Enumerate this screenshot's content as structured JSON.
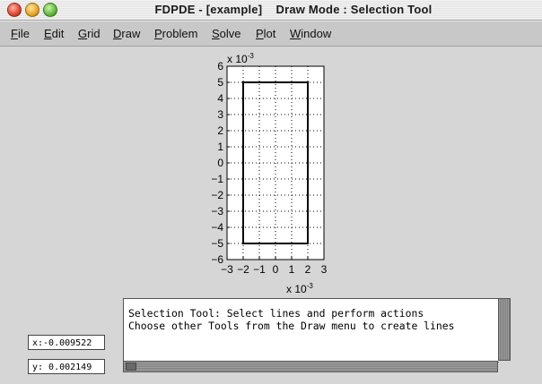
{
  "window": {
    "title": "FDPDE - [example]    Draw Mode : Selection Tool"
  },
  "menu": [
    {
      "label": "File",
      "mnemonic": "F",
      "rest": "ile"
    },
    {
      "label": "Edit",
      "mnemonic": "E",
      "rest": "dit"
    },
    {
      "label": "Grid",
      "mnemonic": "G",
      "rest": "rid"
    },
    {
      "label": "Draw",
      "mnemonic": "D",
      "rest": "raw"
    },
    {
      "label": "Problem",
      "mnemonic": "P",
      "rest": "roblem"
    },
    {
      "label": "Solve",
      "mnemonic": "S",
      "rest": "olve"
    },
    {
      "label": "Plot",
      "mnemonic": "P",
      "rest": "lot"
    },
    {
      "label": "Window",
      "mnemonic": "W",
      "rest": "indow"
    }
  ],
  "plot": {
    "x_ticks": [
      -3,
      -2,
      -1,
      0,
      1,
      2,
      3
    ],
    "y_ticks": [
      -6,
      -5,
      -4,
      -3,
      -2,
      -1,
      0,
      1,
      2,
      3,
      4,
      5,
      6
    ],
    "x_exponent_label": "x 10",
    "x_exponent": "-3",
    "y_exponent_label": "x 10",
    "y_exponent": "-3",
    "xlim": [
      -3,
      3
    ],
    "ylim": [
      -6,
      6
    ],
    "grid": "dotted",
    "rectangle": {
      "x": [
        -2,
        2
      ],
      "y": [
        -5,
        5
      ]
    }
  },
  "messages": {
    "line1": "Selection Tool: Select lines and perform actions",
    "line2": "Choose other Tools from the Draw menu to create lines"
  },
  "coords": {
    "x": "x:-0.009522",
    "y": "y: 0.002149"
  }
}
